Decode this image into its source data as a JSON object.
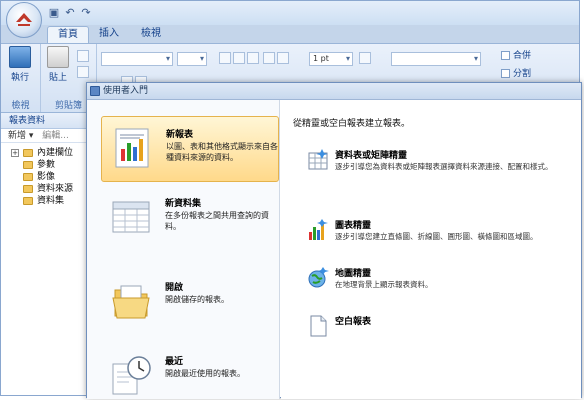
{
  "tabs": [
    "首頁",
    "插入",
    "檢視"
  ],
  "ribbon": {
    "run_label": "執行",
    "view_group_label": "檢視",
    "paste_label": "貼上",
    "clipboard_group_label": "剪貼簿",
    "font_size_value": "1 pt",
    "merge_label": "合併",
    "split_label": "分割"
  },
  "data_pane": {
    "title": "報表資料",
    "new_label": "新增 ▾",
    "edit_label": "編輯...",
    "tree": [
      "內建欄位",
      "參數",
      "影像",
      "資料來源",
      "資料集"
    ]
  },
  "dialog": {
    "title": "使用者入門",
    "options": [
      {
        "title": "新報表",
        "desc": "以圖、表和其他格式顯示來自各種資料來源的資料。"
      },
      {
        "title": "新資料集",
        "desc": "在多份報表之間共用查詢的資料。"
      },
      {
        "title": "開啟",
        "desc": "開啟儲存的報表。"
      },
      {
        "title": "最近",
        "desc": "開啟最近使用的報表。"
      }
    ],
    "right_header": "從精靈或空白報表建立報表。",
    "wizards": [
      {
        "title": "資料表或矩陣精靈",
        "desc": "逐步引導您為資料表或矩陣報表選擇資料來源連接、配置和樣式。"
      },
      {
        "title": "圖表精靈",
        "desc": "逐步引導您建立直條圖、折線圖、圓形圖、橫條圖和區域圖。"
      },
      {
        "title": "地圖精靈",
        "desc": "在地理背景上顯示報表資料。"
      },
      {
        "title": "空白報表",
        "desc": ""
      }
    ]
  }
}
